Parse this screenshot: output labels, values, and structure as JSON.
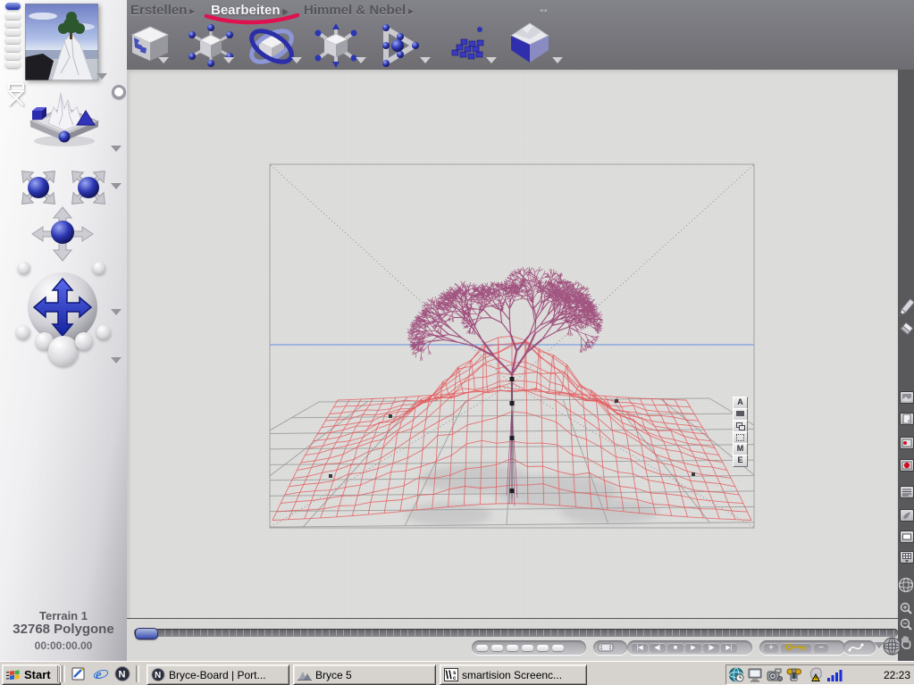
{
  "menu": {
    "items": [
      {
        "label": "Erstellen",
        "arrow": "▸"
      },
      {
        "label": "Bearbeiten",
        "arrow": "▸"
      },
      {
        "label": "Himmel & Nebel",
        "arrow": "▸"
      }
    ],
    "active_index": 1,
    "resize_glyph": "↔"
  },
  "toolbar": {
    "tools": [
      "edit-textures",
      "resize",
      "rotate",
      "reposition",
      "align",
      "multi-replicate",
      "terrain-editor"
    ]
  },
  "status": {
    "object_name": "Terrain 1",
    "polygon_count": "32768 Polygone",
    "timecode": "00:00:00.00"
  },
  "attribute_panel": {
    "attributes_label": "A",
    "material_label": "M",
    "edit_label": "E"
  },
  "taskbar": {
    "start_label": "Start",
    "tasks": [
      {
        "label": "Bryce-Board | Port..."
      },
      {
        "label": "Bryce 5"
      },
      {
        "label": "smartision Screenc..."
      }
    ],
    "clock": "22:23",
    "netscape_glyph": "N",
    "ie_glyph": "e",
    "screencorder_glyph": "\\\\",
    "screencorder_sub_top": "s",
    "screencorder_sub_bottom": "c"
  },
  "scene": {
    "colors": {
      "tree": "#9a4575",
      "terrain": "#e4575a",
      "horizon": "#7aa0dd",
      "grid": "#9b9b9b",
      "guides": "#8f8f8f",
      "handle": "#1e1e22",
      "swoosh": "#e0114f"
    }
  }
}
